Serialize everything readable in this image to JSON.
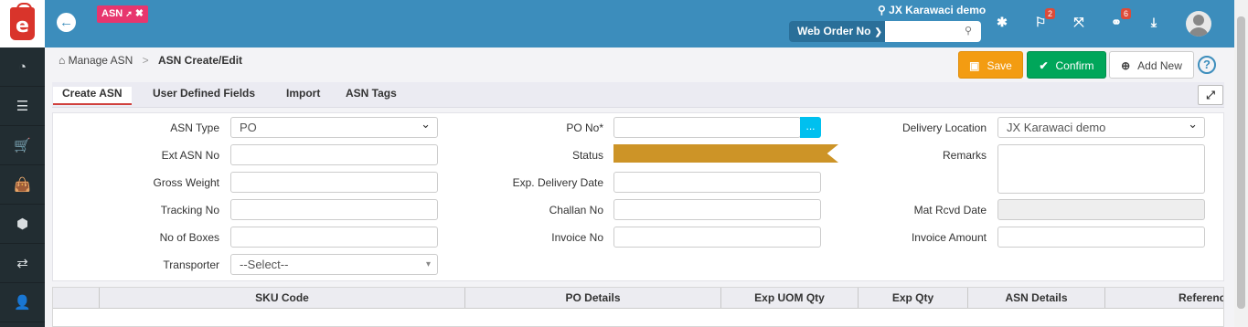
{
  "app": {
    "logo_letter": "e"
  },
  "header": {
    "back_icon": "arrow-left-icon",
    "tag_label": "ASN",
    "tag_pin": "📌",
    "tag_close": "✖",
    "location_icon": "map-marker-icon",
    "location": "JX Karawaci demo",
    "search_type": "Web Order No",
    "search_placeholder": "",
    "search_icon": "search-icon",
    "notif_flags_count": "2",
    "notif_links_count": "6"
  },
  "sidebar": {
    "items": [
      {
        "icon": "dashboard-icon",
        "glyph": "◔"
      },
      {
        "icon": "list-indent-icon",
        "glyph": "☰"
      },
      {
        "icon": "cart-icon",
        "glyph": "🛒"
      },
      {
        "icon": "shopping-bag-icon",
        "glyph": "👜"
      },
      {
        "icon": "cubes-icon",
        "glyph": "⬢"
      },
      {
        "icon": "exchange-icon",
        "glyph": "⇄"
      },
      {
        "icon": "user-plus-icon",
        "glyph": "👤"
      }
    ]
  },
  "breadcrumb": {
    "home_icon": "home-icon",
    "parent": "Manage ASN",
    "separator": ">",
    "current": "ASN Create/Edit"
  },
  "actions": {
    "save": "Save",
    "confirm": "Confirm",
    "add_new": "Add New",
    "help": "?"
  },
  "tabs": [
    "Create ASN",
    "User Defined Fields",
    "Import",
    "ASN Tags"
  ],
  "form": {
    "asn_type_label": "ASN Type",
    "asn_type_value": "PO",
    "ext_asn_label": "Ext ASN No",
    "ext_asn_value": "",
    "gross_weight_label": "Gross Weight",
    "gross_weight_value": "",
    "tracking_label": "Tracking No",
    "tracking_value": "",
    "boxes_label": "No of Boxes",
    "boxes_value": "",
    "transporter_label": "Transporter",
    "transporter_value": "--Select--",
    "po_no_label": "PO No*",
    "po_no_value": "",
    "po_lookup": "...",
    "status_label": "Status",
    "exp_delivery_label": "Exp. Delivery Date",
    "exp_delivery_value": "",
    "challan_label": "Challan No",
    "challan_value": "",
    "invoice_label": "Invoice No",
    "invoice_value": "",
    "delivery_loc_label": "Delivery Location",
    "delivery_loc_value": "JX Karawaci demo",
    "remarks_label": "Remarks",
    "remarks_value": "",
    "mat_rcvd_label": "Mat Rcvd Date",
    "mat_rcvd_value": "",
    "invoice_amount_label": "Invoice Amount",
    "invoice_amount_value": ""
  },
  "grid": {
    "columns": [
      "",
      "SKU Code",
      "PO Details",
      "Exp UOM Qty",
      "Exp Qty",
      "ASN Details",
      "Referenc"
    ]
  },
  "colors": {
    "header": "#3c8dbc",
    "sidebar": "#222d32",
    "save": "#f39c12",
    "confirm": "#00a65a",
    "status": "#cd9427",
    "tag": "#e7366e"
  }
}
